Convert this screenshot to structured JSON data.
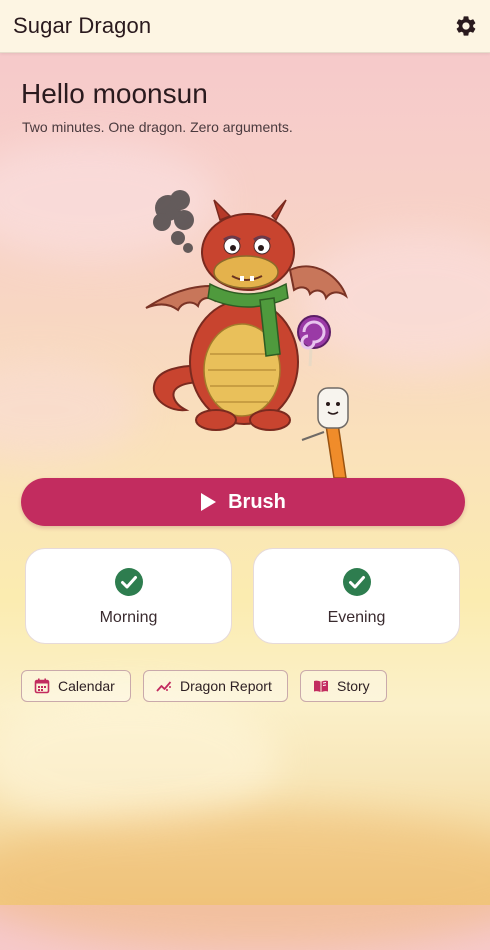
{
  "app": {
    "title": "Sugar Dragon"
  },
  "header": {
    "settings_icon": "gear-icon"
  },
  "greeting": {
    "title": "Hello moonsun",
    "tagline": "Two minutes. One dragon. Zero arguments."
  },
  "brush": {
    "label": "Brush",
    "icon": "play-icon",
    "color": "#c22c5f"
  },
  "sessions": [
    {
      "label": "Morning",
      "completed": true,
      "icon": "check-circle-icon"
    },
    {
      "label": "Evening",
      "completed": true,
      "icon": "check-circle-icon"
    }
  ],
  "check_color": "#2e7d4f",
  "links": [
    {
      "label": "Calendar",
      "icon": "calendar-icon"
    },
    {
      "label": "Dragon Report",
      "icon": "trend-chart-icon"
    },
    {
      "label": "Story",
      "icon": "book-icon"
    }
  ],
  "accent_color": "#c22c5f"
}
